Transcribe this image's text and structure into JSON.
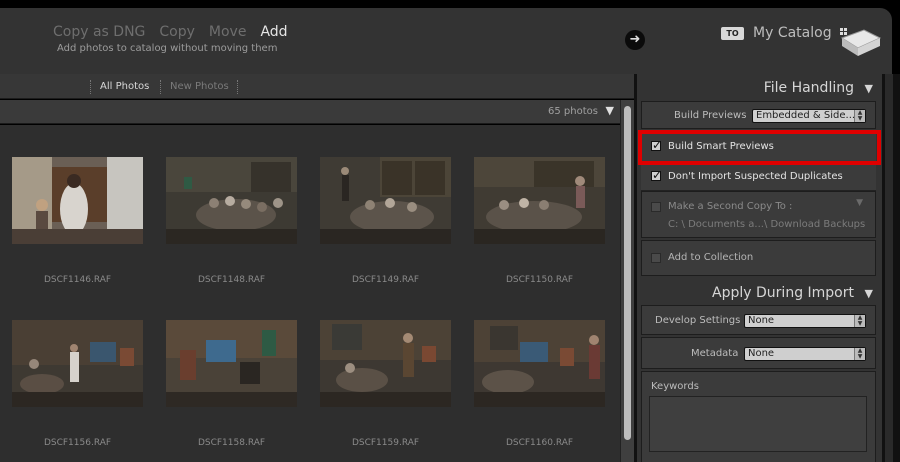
{
  "modes": {
    "copy_as_dng": "Copy as DNG",
    "copy": "Copy",
    "move": "Move",
    "add": "Add",
    "active": "Add",
    "subtitle": "Add photos to catalog without moving them"
  },
  "destination": {
    "to_badge": "TO",
    "catalog": "My Catalog",
    "icon": "hard-drive-icon"
  },
  "filters": {
    "all": "All Photos",
    "new": "New Photos",
    "active": "All Photos"
  },
  "grid": {
    "photo_count": "65 photos",
    "photos": [
      {
        "filename": "DSCF1146.RAF"
      },
      {
        "filename": "DSCF1148.RAF"
      },
      {
        "filename": "DSCF1149.RAF"
      },
      {
        "filename": "DSCF1150.RAF"
      },
      {
        "filename": "DSCF1156.RAF"
      },
      {
        "filename": "DSCF1158.RAF"
      },
      {
        "filename": "DSCF1159.RAF"
      },
      {
        "filename": "DSCF1160.RAF"
      }
    ]
  },
  "file_handling": {
    "title": "File Handling",
    "build_previews_label": "Build Previews",
    "build_previews_value": "Embedded & Side...",
    "build_smart_previews": {
      "label": "Build Smart Previews",
      "checked": true
    },
    "dont_import_duplicates": {
      "label": "Don't Import Suspected Duplicates",
      "checked": true
    },
    "second_copy": {
      "label": "Make a Second Copy To :",
      "checked": false,
      "path": "C: \\ Documents a...\\ Download Backups"
    },
    "add_to_collection": {
      "label": "Add to Collection",
      "checked": false
    }
  },
  "apply_during_import": {
    "title": "Apply During Import",
    "develop_settings_label": "Develop Settings",
    "develop_settings_value": "None",
    "metadata_label": "Metadata",
    "metadata_value": "None",
    "keywords_label": "Keywords"
  },
  "colors": {
    "highlight": "#e00000",
    "panel": "#333333",
    "accent_text": "#e6e6e6"
  }
}
